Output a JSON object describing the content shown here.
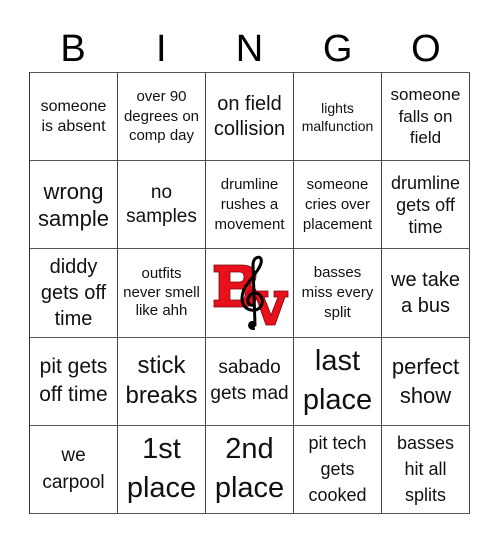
{
  "header": {
    "letters": [
      "B",
      "I",
      "N",
      "G",
      "O"
    ]
  },
  "card": {
    "rows": [
      [
        "someone is absent",
        "over 90 degrees on comp day",
        "on field collision",
        "lights malfunction",
        "someone falls on field"
      ],
      [
        "wrong sample",
        "no samples",
        "drumline rushes a movement",
        "someone cries over placement",
        "drumline gets off time"
      ],
      [
        "diddy gets off time",
        "outfits never smell like ahh",
        "",
        "basses miss every split",
        "we take a bus"
      ],
      [
        "pit gets off time",
        "stick breaks",
        "sabado gets mad",
        "last place",
        "perfect show"
      ],
      [
        "we carpool",
        "1st place",
        "2nd place",
        "pit tech gets cooked",
        "basses hit all splits"
      ]
    ],
    "free_space": {
      "icon": "bv-treble-clef-logo",
      "letters": [
        "B",
        "V"
      ]
    }
  },
  "colors": {
    "logo_red": "#e8101a",
    "logo_outline": "#7a0a0a",
    "clef": "#000000",
    "grid_line": "#444444"
  }
}
